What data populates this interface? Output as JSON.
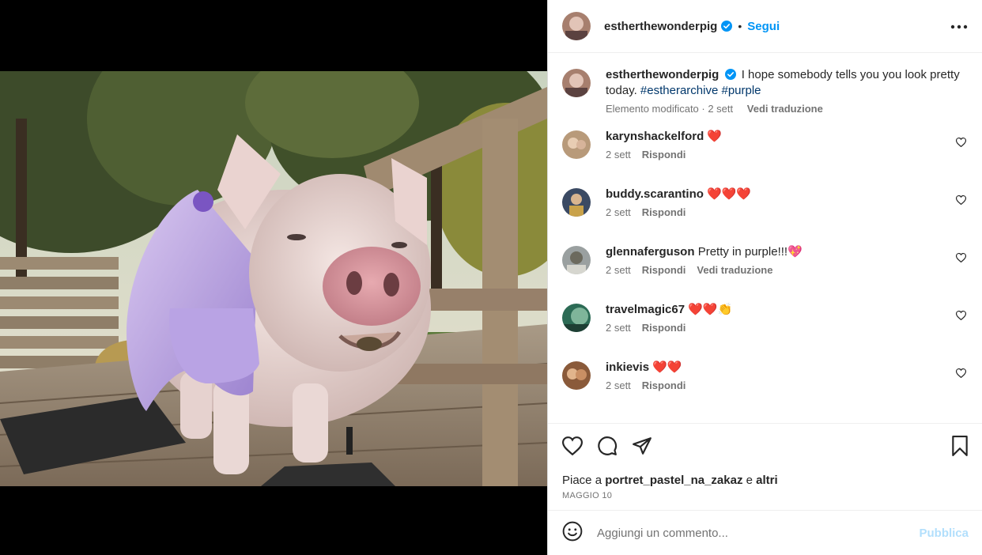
{
  "post": {
    "username": "estherthewonderpig",
    "follow_label": "Segui",
    "separator": "•"
  },
  "caption": {
    "username": "estherthewonderpig",
    "text": "I hope somebody tells you you look pretty today.",
    "hashtags": [
      "#estherarchive",
      "#purple"
    ],
    "edited": "Elemento modificato · 2 sett",
    "translate": "Vedi traduzione"
  },
  "comments": [
    {
      "username": "karynshackelford",
      "text": "❤️",
      "time": "2 sett",
      "reply": "Rispondi",
      "avatar_color": "#b89a7a"
    },
    {
      "username": "buddy.scarantino",
      "text": "❤️❤️❤️",
      "time": "2 sett",
      "reply": "Rispondi",
      "avatar_color": "#3b4a63"
    },
    {
      "username": "glennaferguson",
      "text": "Pretty in purple!!!💖",
      "time": "2 sett",
      "reply": "Rispondi",
      "translate": "Vedi traduzione",
      "avatar_color": "#9aa0a0"
    },
    {
      "username": "travelmagic67",
      "text": "❤️❤️👏",
      "time": "2 sett",
      "reply": "Rispondi",
      "avatar_color": "#2c6b55"
    },
    {
      "username": "inkievis",
      "text": "❤️❤️",
      "time": "2 sett",
      "reply": "Rispondi",
      "avatar_color": "#8a5a3a"
    }
  ],
  "likes": {
    "prefix": "Piace a",
    "user": "portret_pastel_na_zakaz",
    "conj": "e",
    "others": "altri"
  },
  "date": "MAGGIO 10",
  "add_comment": {
    "placeholder": "Aggiungi un commento...",
    "post_label": "Pubblica"
  },
  "colors": {
    "accent": "#0095f6",
    "link": "#00376b",
    "muted": "#737373",
    "post_disabled": "#b2dffc"
  },
  "icons": {
    "verified": "verified-badge-icon",
    "more": "more-options-icon",
    "like": "heart-icon",
    "comment": "comment-icon",
    "share": "share-icon",
    "save": "bookmark-icon",
    "emoji": "emoji-icon"
  }
}
